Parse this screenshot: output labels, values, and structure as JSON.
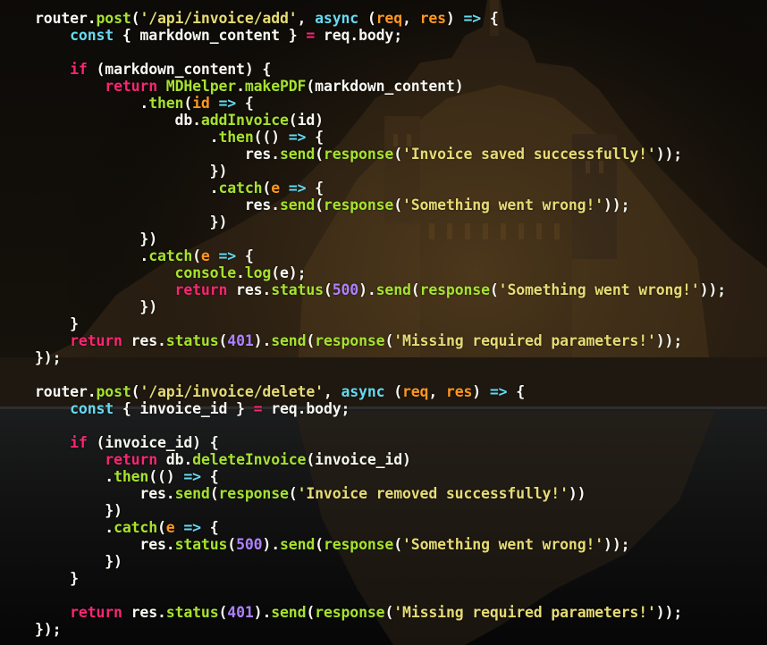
{
  "colors": {
    "plain": "#f8f8f2",
    "function": "#a6e22e",
    "string": "#e6db74",
    "keyword": "#66d9ef",
    "control": "#f92672",
    "parameter": "#fd971f",
    "number": "#ae81ff",
    "background": "#0b0907"
  },
  "code_lines": [
    [
      [
        "id",
        "router"
      ],
      [
        "pn",
        "."
      ],
      [
        "fn",
        "post"
      ],
      [
        "pn",
        "("
      ],
      [
        "str",
        "'/api/invoice/add'"
      ],
      [
        "pn",
        ", "
      ],
      [
        "kw",
        "async"
      ],
      [
        "pn",
        " ("
      ],
      [
        "par",
        "req"
      ],
      [
        "pn",
        ", "
      ],
      [
        "par",
        "res"
      ],
      [
        "pn",
        ") "
      ],
      [
        "kw",
        "=>"
      ],
      [
        "pn",
        " {"
      ]
    ],
    [
      [
        "pn",
        "    "
      ],
      [
        "kw",
        "const"
      ],
      [
        "pn",
        " { "
      ],
      [
        "id",
        "markdown_content"
      ],
      [
        "pn",
        " } "
      ],
      [
        "ctl",
        "="
      ],
      [
        "pn",
        " "
      ],
      [
        "id",
        "req"
      ],
      [
        "pn",
        "."
      ],
      [
        "id",
        "body"
      ],
      [
        "pn",
        ";"
      ]
    ],
    [],
    [
      [
        "pn",
        "    "
      ],
      [
        "ctl",
        "if"
      ],
      [
        "pn",
        " ("
      ],
      [
        "id",
        "markdown_content"
      ],
      [
        "pn",
        ") {"
      ]
    ],
    [
      [
        "pn",
        "        "
      ],
      [
        "ctl",
        "return"
      ],
      [
        "pn",
        " "
      ],
      [
        "fn",
        "MDHelper"
      ],
      [
        "pn",
        "."
      ],
      [
        "fn",
        "makePDF"
      ],
      [
        "pn",
        "("
      ],
      [
        "id",
        "markdown_content"
      ],
      [
        "pn",
        ")"
      ]
    ],
    [
      [
        "pn",
        "            ."
      ],
      [
        "fn",
        "then"
      ],
      [
        "pn",
        "("
      ],
      [
        "par",
        "id"
      ],
      [
        "pn",
        " "
      ],
      [
        "kw",
        "=>"
      ],
      [
        "pn",
        " {"
      ]
    ],
    [
      [
        "pn",
        "                "
      ],
      [
        "id",
        "db"
      ],
      [
        "pn",
        "."
      ],
      [
        "fn",
        "addInvoice"
      ],
      [
        "pn",
        "("
      ],
      [
        "id",
        "id"
      ],
      [
        "pn",
        ")"
      ]
    ],
    [
      [
        "pn",
        "                    ."
      ],
      [
        "fn",
        "then"
      ],
      [
        "pn",
        "(() "
      ],
      [
        "kw",
        "=>"
      ],
      [
        "pn",
        " {"
      ]
    ],
    [
      [
        "pn",
        "                        "
      ],
      [
        "id",
        "res"
      ],
      [
        "pn",
        "."
      ],
      [
        "fn",
        "send"
      ],
      [
        "pn",
        "("
      ],
      [
        "fn",
        "response"
      ],
      [
        "pn",
        "("
      ],
      [
        "str",
        "'Invoice saved successfully!'"
      ],
      [
        "pn",
        "));"
      ]
    ],
    [
      [
        "pn",
        "                    })"
      ]
    ],
    [
      [
        "pn",
        "                    ."
      ],
      [
        "fn",
        "catch"
      ],
      [
        "pn",
        "("
      ],
      [
        "par",
        "e"
      ],
      [
        "pn",
        " "
      ],
      [
        "kw",
        "=>"
      ],
      [
        "pn",
        " {"
      ]
    ],
    [
      [
        "pn",
        "                        "
      ],
      [
        "id",
        "res"
      ],
      [
        "pn",
        "."
      ],
      [
        "fn",
        "send"
      ],
      [
        "pn",
        "("
      ],
      [
        "fn",
        "response"
      ],
      [
        "pn",
        "("
      ],
      [
        "str",
        "'Something went wrong!'"
      ],
      [
        "pn",
        "));"
      ]
    ],
    [
      [
        "pn",
        "                    })"
      ]
    ],
    [
      [
        "pn",
        "            })"
      ]
    ],
    [
      [
        "pn",
        "            ."
      ],
      [
        "fn",
        "catch"
      ],
      [
        "pn",
        "("
      ],
      [
        "par",
        "e"
      ],
      [
        "pn",
        " "
      ],
      [
        "kw",
        "=>"
      ],
      [
        "pn",
        " {"
      ]
    ],
    [
      [
        "pn",
        "                "
      ],
      [
        "fn",
        "console"
      ],
      [
        "pn",
        "."
      ],
      [
        "fn",
        "log"
      ],
      [
        "pn",
        "("
      ],
      [
        "id",
        "e"
      ],
      [
        "pn",
        ");"
      ]
    ],
    [
      [
        "pn",
        "                "
      ],
      [
        "ctl",
        "return"
      ],
      [
        "pn",
        " "
      ],
      [
        "id",
        "res"
      ],
      [
        "pn",
        "."
      ],
      [
        "fn",
        "status"
      ],
      [
        "pn",
        "("
      ],
      [
        "num",
        "500"
      ],
      [
        "pn",
        ")."
      ],
      [
        "fn",
        "send"
      ],
      [
        "pn",
        "("
      ],
      [
        "fn",
        "response"
      ],
      [
        "pn",
        "("
      ],
      [
        "str",
        "'Something went wrong!'"
      ],
      [
        "pn",
        "));"
      ]
    ],
    [
      [
        "pn",
        "            })"
      ]
    ],
    [
      [
        "pn",
        "    }"
      ]
    ],
    [
      [
        "pn",
        "    "
      ],
      [
        "ctl",
        "return"
      ],
      [
        "pn",
        " "
      ],
      [
        "id",
        "res"
      ],
      [
        "pn",
        "."
      ],
      [
        "fn",
        "status"
      ],
      [
        "pn",
        "("
      ],
      [
        "num",
        "401"
      ],
      [
        "pn",
        ")."
      ],
      [
        "fn",
        "send"
      ],
      [
        "pn",
        "("
      ],
      [
        "fn",
        "response"
      ],
      [
        "pn",
        "("
      ],
      [
        "str",
        "'Missing required parameters!'"
      ],
      [
        "pn",
        "));"
      ]
    ],
    [
      [
        "pn",
        "});"
      ]
    ],
    [],
    [
      [
        "id",
        "router"
      ],
      [
        "pn",
        "."
      ],
      [
        "fn",
        "post"
      ],
      [
        "pn",
        "("
      ],
      [
        "str",
        "'/api/invoice/delete'"
      ],
      [
        "pn",
        ", "
      ],
      [
        "kw",
        "async"
      ],
      [
        "pn",
        " ("
      ],
      [
        "par",
        "req"
      ],
      [
        "pn",
        ", "
      ],
      [
        "par",
        "res"
      ],
      [
        "pn",
        ") "
      ],
      [
        "kw",
        "=>"
      ],
      [
        "pn",
        " {"
      ]
    ],
    [
      [
        "pn",
        "    "
      ],
      [
        "kw",
        "const"
      ],
      [
        "pn",
        " { "
      ],
      [
        "id",
        "invoice_id"
      ],
      [
        "pn",
        " } "
      ],
      [
        "ctl",
        "="
      ],
      [
        "pn",
        " "
      ],
      [
        "id",
        "req"
      ],
      [
        "pn",
        "."
      ],
      [
        "id",
        "body"
      ],
      [
        "pn",
        ";"
      ]
    ],
    [],
    [
      [
        "pn",
        "    "
      ],
      [
        "ctl",
        "if"
      ],
      [
        "pn",
        " ("
      ],
      [
        "id",
        "invoice_id"
      ],
      [
        "pn",
        ") {"
      ]
    ],
    [
      [
        "pn",
        "        "
      ],
      [
        "ctl",
        "return"
      ],
      [
        "pn",
        " "
      ],
      [
        "id",
        "db"
      ],
      [
        "pn",
        "."
      ],
      [
        "fn",
        "deleteInvoice"
      ],
      [
        "pn",
        "("
      ],
      [
        "id",
        "invoice_id"
      ],
      [
        "pn",
        ")"
      ]
    ],
    [
      [
        "pn",
        "        ."
      ],
      [
        "fn",
        "then"
      ],
      [
        "pn",
        "(() "
      ],
      [
        "kw",
        "=>"
      ],
      [
        "pn",
        " {"
      ]
    ],
    [
      [
        "pn",
        "            "
      ],
      [
        "id",
        "res"
      ],
      [
        "pn",
        "."
      ],
      [
        "fn",
        "send"
      ],
      [
        "pn",
        "("
      ],
      [
        "fn",
        "response"
      ],
      [
        "pn",
        "("
      ],
      [
        "str",
        "'Invoice removed successfully!'"
      ],
      [
        "pn",
        "))"
      ]
    ],
    [
      [
        "pn",
        "        })"
      ]
    ],
    [
      [
        "pn",
        "        ."
      ],
      [
        "fn",
        "catch"
      ],
      [
        "pn",
        "("
      ],
      [
        "par",
        "e"
      ],
      [
        "pn",
        " "
      ],
      [
        "kw",
        "=>"
      ],
      [
        "pn",
        " {"
      ]
    ],
    [
      [
        "pn",
        "            "
      ],
      [
        "id",
        "res"
      ],
      [
        "pn",
        "."
      ],
      [
        "fn",
        "status"
      ],
      [
        "pn",
        "("
      ],
      [
        "num",
        "500"
      ],
      [
        "pn",
        ")."
      ],
      [
        "fn",
        "send"
      ],
      [
        "pn",
        "("
      ],
      [
        "fn",
        "response"
      ],
      [
        "pn",
        "("
      ],
      [
        "str",
        "'Something went wrong!'"
      ],
      [
        "pn",
        "));"
      ]
    ],
    [
      [
        "pn",
        "        })"
      ]
    ],
    [
      [
        "pn",
        "    }"
      ]
    ],
    [],
    [
      [
        "pn",
        "    "
      ],
      [
        "ctl",
        "return"
      ],
      [
        "pn",
        " "
      ],
      [
        "id",
        "res"
      ],
      [
        "pn",
        "."
      ],
      [
        "fn",
        "status"
      ],
      [
        "pn",
        "("
      ],
      [
        "num",
        "401"
      ],
      [
        "pn",
        ")."
      ],
      [
        "fn",
        "send"
      ],
      [
        "pn",
        "("
      ],
      [
        "fn",
        "response"
      ],
      [
        "pn",
        "("
      ],
      [
        "str",
        "'Missing required parameters!'"
      ],
      [
        "pn",
        "));"
      ]
    ],
    [
      [
        "pn",
        "});"
      ]
    ]
  ]
}
